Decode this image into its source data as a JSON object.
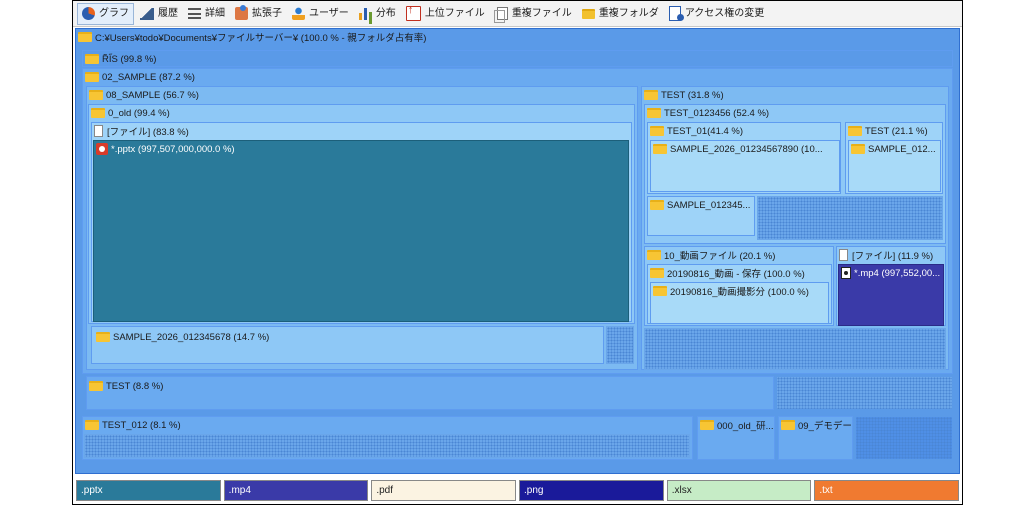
{
  "toolbar": {
    "buttons": [
      {
        "label": "グラフ",
        "icon": "pie-chart-icon"
      },
      {
        "label": "履歴",
        "icon": "history-icon"
      },
      {
        "label": "詳細",
        "icon": "detail-list-icon"
      },
      {
        "label": "拡張子",
        "icon": "extension-icon"
      },
      {
        "label": "ユーザー",
        "icon": "user-icon"
      },
      {
        "label": "分布",
        "icon": "distribution-icon"
      },
      {
        "label": "上位ファイル",
        "icon": "top-files-icon"
      },
      {
        "label": "重複ファイル",
        "icon": "duplicate-file-icon"
      },
      {
        "label": "重複フォルダ",
        "icon": "duplicate-folder-icon"
      },
      {
        "label": "アクセス権の変更",
        "icon": "access-rights-icon"
      }
    ]
  },
  "treemap": {
    "root": "C:¥Users¥todo¥Documents¥ファイルサーバー¥ (100.0 % - 親フォルダ占有率)",
    "n_rs": "R̃I̋S (99.8 %)",
    "n_02": "02_SAMPLE (87.2 %)",
    "n_08": "08_SAMPLE (56.7 %)",
    "n_0old": "0_old (99.4 %)",
    "n_files1": "[ファイル] (83.8 %)",
    "n_pptx": "*.pptx (997,507,000,000.0 %)",
    "n_s2026a": "SAMPLE_2026_012345678 (14.7 %)",
    "n_test1": "TEST  (31.8 %)",
    "n_test0123": "TEST_0123456 (52.4 %)",
    "n_test01": "TEST_01(41.4 %)",
    "n_test_r": "TEST  (21.1 %)",
    "n_s2026b": "SAMPLE_2026_01234567890  (10...",
    "n_s012": "SAMPLE_012...",
    "n_s012345": "SAMPLE_012345...",
    "n_10": "10_動画ファイル (20.1 %)",
    "n_files2": "[ファイル] (11.9 %)",
    "n_20190816a": "20190816_動画 - 保存 (100.0 %)",
    "n_20190816b": "20190816_動画撮影分 (100.0 %)",
    "n_mp4": "*.mp4 (997,552,00...",
    "n_test88": "TEST  (8.8 %)",
    "n_test012": "TEST_012 (8.1 %)",
    "n_000old": "000_old_研...",
    "n_09": "09_デモデー..."
  },
  "legend": [
    {
      "label": ".pptx",
      "color": "#2a7a9a",
      "text": "#ffffff"
    },
    {
      "label": ".mp4",
      "color": "#3a3aa8",
      "text": "#ffffff"
    },
    {
      "label": ".pdf",
      "color": "#fbf3e2",
      "text": "#222222"
    },
    {
      "label": ".png",
      "color": "#1a1a9a",
      "text": "#ffffff"
    },
    {
      "label": ".xlsx",
      "color": "#c6ecc6",
      "text": "#222222"
    },
    {
      "label": ".txt",
      "color": "#f07a30",
      "text": "#ffffff"
    }
  ]
}
